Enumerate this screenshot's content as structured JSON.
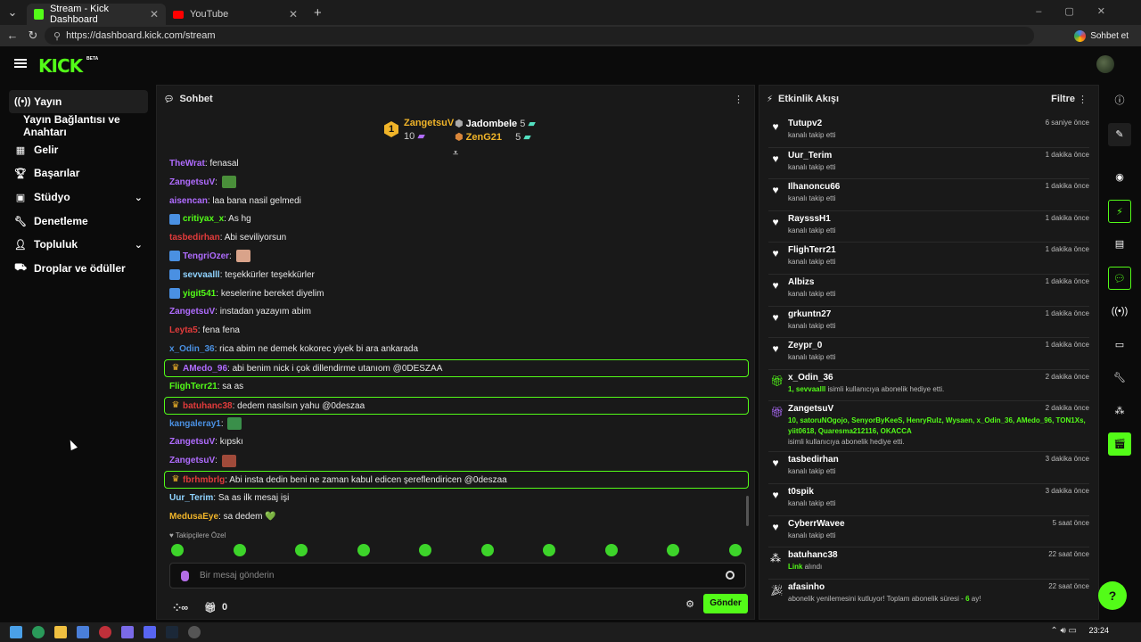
{
  "browser": {
    "tabs": [
      {
        "title": "Stream - Kick Dashboard",
        "active": true
      },
      {
        "title": "YouTube",
        "active": false
      }
    ],
    "url": "https://dashboard.kick.com/stream",
    "copilot_label": "Sohbet et"
  },
  "header": {
    "logo": "KICK",
    "beta": "BETA"
  },
  "sidebar": {
    "items": [
      {
        "label": "Yayın",
        "icon": "broadcast-icon",
        "active": true
      },
      {
        "label": "Yayın Bağlantısı ve Anahtarı",
        "icon": "",
        "active": false
      },
      {
        "label": "Gelir",
        "icon": "revenue-icon"
      },
      {
        "label": "Başarılar",
        "icon": "trophy-icon"
      },
      {
        "label": "Stüdyo",
        "icon": "studio-icon",
        "expandable": true
      },
      {
        "label": "Denetleme",
        "icon": "wrench-icon"
      },
      {
        "label": "Topluluk",
        "icon": "community-icon",
        "expandable": true
      },
      {
        "label": "Droplar ve ödüller",
        "icon": "drops-icon"
      }
    ]
  },
  "chat": {
    "title": "Sohbet",
    "leaderboard": [
      {
        "rank": "1",
        "name": "ZangetsuV",
        "count": "10"
      },
      {
        "name": "Jadombele",
        "count": "5"
      },
      {
        "name": "ZenG21",
        "count": "5"
      }
    ],
    "messages": [
      {
        "user": "TheWrat",
        "color": "#b06cff",
        "text": "fenasal"
      },
      {
        "user": "ZangetsuV",
        "color": "#b06cff",
        "text": "",
        "emote": "#4a8f3a"
      },
      {
        "user": "aisencan",
        "color": "#b06cff",
        "text": "laa bana nasil gelmedi"
      },
      {
        "user": "critiyax_x",
        "color": "#53fc18",
        "text": "As hg",
        "badges": true
      },
      {
        "user": "tasbedirhan",
        "color": "#e23b3b",
        "text": "Abi seviliyorsun"
      },
      {
        "user": "TengriOzer",
        "color": "#b06cff",
        "text": "",
        "emote": "#d9a38a",
        "badges": true
      },
      {
        "user": "sevvaalll",
        "color": "#8fd3ff",
        "text": "teşekkürler teşekkürler",
        "badges": true
      },
      {
        "user": "yigit541",
        "color": "#53fc18",
        "text": "keselerine bereket diyelim",
        "badges": true
      },
      {
        "user": "ZangetsuV",
        "color": "#b06cff",
        "text": "instadan yazayım abim"
      },
      {
        "user": "Leyta5",
        "color": "#e23b3b",
        "text": "fena fena"
      },
      {
        "user": "x_Odin_36",
        "color": "#4a90e2",
        "text": "rica abim ne demek kokorec yiyek bi ara ankarada"
      },
      {
        "user": "AMedo_96",
        "color": "#b06cff",
        "text": "abi benim nick i çok dillendirme utanıom @0DESZAA",
        "highlight": true
      },
      {
        "user": "FlighTerr21",
        "color": "#53fc18",
        "text": "sa as"
      },
      {
        "user": "batuhanc38",
        "color": "#e23b3b",
        "text": "dedem nasılsın yahu @0deszaa",
        "highlight": true
      },
      {
        "user": "kangaleray1",
        "color": "#4a90e2",
        "text": "",
        "emote": "#3a8f4a"
      },
      {
        "user": "ZangetsuV",
        "color": "#b06cff",
        "text": "kıpskı"
      },
      {
        "user": "ZangetsuV",
        "color": "#b06cff",
        "text": "",
        "emote": "#a04a3a"
      },
      {
        "user": "fbrhmbrlg",
        "color": "#e23b3b",
        "text": "Abi insta dedin beni ne zaman kabul edicen şereflendiricen @0deszaa",
        "highlight": true
      },
      {
        "user": "Uur_Terim",
        "color": "#8fd3ff",
        "text": "Sa as ilk mesaj işi"
      },
      {
        "user": "MedusaEye",
        "color": "#f0b429",
        "text": "sa dedem 💚"
      }
    ],
    "followers_label": "Takipçilere Özel",
    "input_placeholder": "Bir mesaj gönderin",
    "points": "0",
    "send_label": "Gönder"
  },
  "feed": {
    "title": "Etkinlik Akışı",
    "filter_label": "Filtre",
    "items": [
      {
        "name": "Tutupv2",
        "action": "kanalı takip etti",
        "time": "6 saniye önce",
        "icon": "heart-icon"
      },
      {
        "name": "Uur_Terim",
        "action": "kanalı takip etti",
        "time": "1 dakika önce",
        "icon": "heart-icon"
      },
      {
        "name": "Ilhanoncu66",
        "action": "kanalı takip etti",
        "time": "1 dakika önce",
        "icon": "heart-icon"
      },
      {
        "name": "RaysssH1",
        "action": "kanalı takip etti",
        "time": "1 dakika önce",
        "icon": "heart-icon"
      },
      {
        "name": "FlighTerr21",
        "action": "kanalı takip etti",
        "time": "1 dakika önce",
        "icon": "heart-icon"
      },
      {
        "name": "Albizs",
        "action": "kanalı takip etti",
        "time": "1 dakika önce",
        "icon": "heart-icon"
      },
      {
        "name": "grkuntn27",
        "action": "kanalı takip etti",
        "time": "1 dakika önce",
        "icon": "heart-icon"
      },
      {
        "name": "Zeypr_0",
        "action": "kanalı takip etti",
        "time": "1 dakika önce",
        "icon": "heart-icon"
      },
      {
        "name": "x_Odin_36",
        "highlight": "1, sevvaalll",
        "action": " isimli kullanıcıya abonelik hediye etti.",
        "time": "2 dakika önce",
        "icon": "gift-icon"
      },
      {
        "name": "ZangetsuV",
        "highlight": "10, satoruNOgojo, SenyorByKeeS, HenryRulz, Wysaen, x_Odin_36, AMedo_96, TON1Xs, yiit0618, Quaresma212116, OKACCA",
        "action": "isimli kullanıcıya abonelik hediye etti.",
        "time": "2 dakika önce",
        "icon": "gift-icon"
      },
      {
        "name": "tasbedirhan",
        "action": "kanalı takip etti",
        "time": "3 dakika önce",
        "icon": "heart-icon"
      },
      {
        "name": "t0spik",
        "action": "kanalı takip etti",
        "time": "3 dakika önce",
        "icon": "heart-icon"
      },
      {
        "name": "CyberrWavee",
        "action": "kanalı takip etti",
        "time": "5 saat önce",
        "icon": "heart-icon"
      },
      {
        "name": "batuhanc38",
        "highlight": "Link",
        "action": " alındı",
        "time": "22 saat önce",
        "icon": "reward-icon"
      },
      {
        "name": "afasinho",
        "action": "abonelik yenilemesini kutluyor! Toplam abonelik süresi - ",
        "highlight2": "6",
        "action2": " ay!",
        "time": "22 saat önce",
        "icon": "party-icon"
      }
    ]
  },
  "taskbar": {
    "time": "23:24"
  }
}
